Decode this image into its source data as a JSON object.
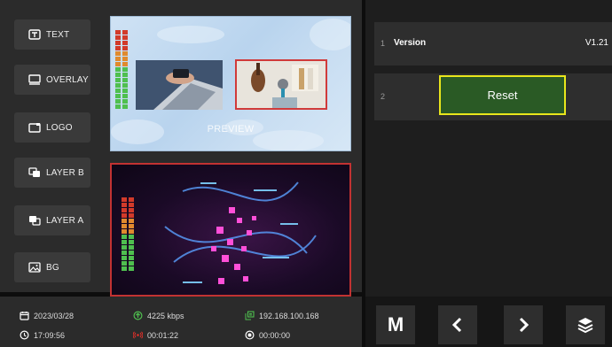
{
  "sidebar": {
    "items": [
      {
        "label": "TEXT",
        "icon": "text-box-icon"
      },
      {
        "label": "OVERLAY",
        "icon": "overlay-icon"
      },
      {
        "label": "LOGO",
        "icon": "logo-icon"
      },
      {
        "label": "LAYER B",
        "icon": "layer-b-icon"
      },
      {
        "label": "LAYER A",
        "icon": "layer-a-icon"
      },
      {
        "label": "BG",
        "icon": "image-icon"
      }
    ]
  },
  "preview": {
    "label": "PREVIEW"
  },
  "settings": {
    "rows": [
      {
        "index": "1",
        "label": "Version",
        "value": "V1.21"
      },
      {
        "index": "2",
        "button": "Reset"
      }
    ]
  },
  "status": {
    "date": "2023/03/28",
    "time": "17:09:56",
    "bitrate": "4225 kbps",
    "stream_time": "00:01:22",
    "ip": "192.168.100.168",
    "record_time": "00:00:00"
  },
  "nav": {
    "m_label": "M"
  },
  "colors": {
    "accent_red": "#c23232",
    "highlight_yellow": "#e9e61c",
    "button_green": "#2a5a25",
    "meter_green": "#4fbf4f",
    "meter_orange": "#e08a2e",
    "meter_red": "#d23a2a"
  }
}
